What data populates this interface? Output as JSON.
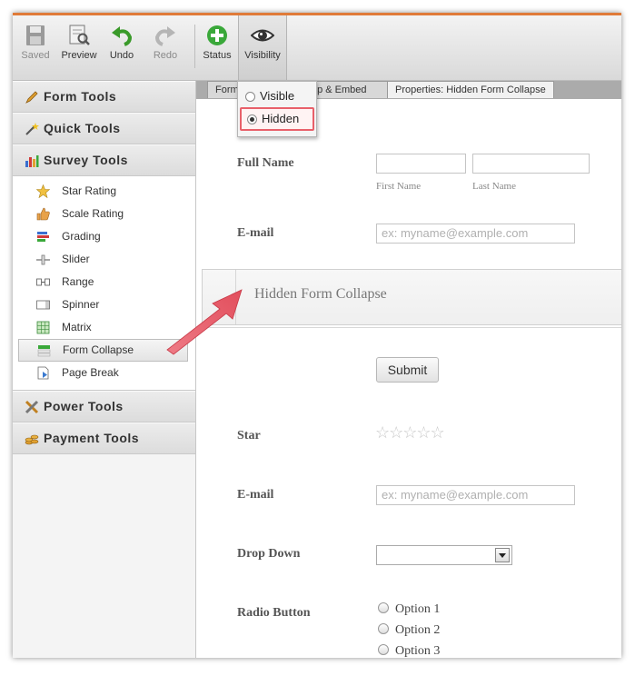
{
  "toolbar": {
    "saved_label": "Saved",
    "preview_label": "Preview",
    "undo_label": "Undo",
    "redo_label": "Redo",
    "status_label": "Status",
    "visibility_label": "Visibility"
  },
  "visibility_menu": {
    "visible_label": "Visible",
    "hidden_label": "Hidden",
    "selected": "Hidden"
  },
  "sidebar": {
    "categories": {
      "form_tools": "Form Tools",
      "quick_tools": "Quick Tools",
      "survey_tools": "Survey Tools",
      "power_tools": "Power Tools",
      "payment_tools": "Payment Tools"
    },
    "survey_items": [
      "Star Rating",
      "Scale Rating",
      "Grading",
      "Slider",
      "Range",
      "Spinner",
      "Matrix",
      "Form Collapse",
      "Page Break"
    ],
    "selected_item": "Form Collapse"
  },
  "tabs": {
    "tab1": "Form",
    "tab2": "up & Embed",
    "tab3": "Properties: Hidden Form Collapse"
  },
  "form": {
    "full_name_label": "Full Name",
    "first_name_sub": "First Name",
    "last_name_sub": "Last Name",
    "email_label": "E-mail",
    "email_placeholder": "ex: myname@example.com",
    "collapse_title": "Hidden Form Collapse",
    "submit_label": "Submit",
    "star_label": "Star",
    "stars": "☆☆☆☆☆",
    "email2_label": "E-mail",
    "email2_placeholder": "ex: myname@example.com",
    "dropdown_label": "Drop Down",
    "radio_label": "Radio Button",
    "radio_options": [
      "Option 1",
      "Option 2",
      "Option 3"
    ]
  },
  "colors": {
    "accent": "#e07b39",
    "highlight": "#e8606a",
    "arrow": "#e8606a"
  }
}
